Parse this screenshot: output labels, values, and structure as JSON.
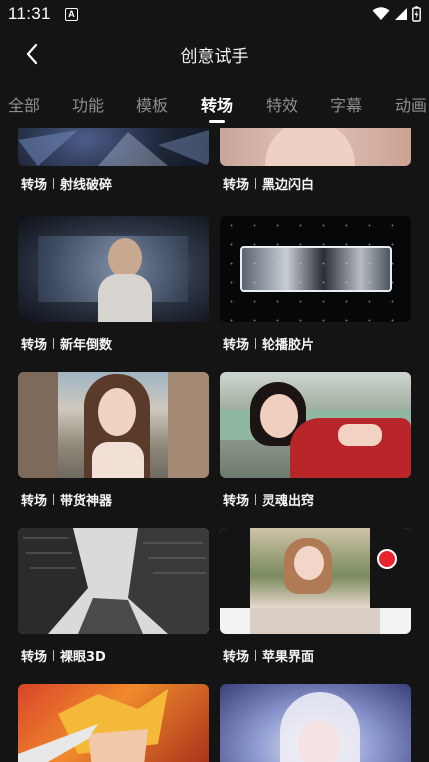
{
  "status": {
    "time": "11:31",
    "a_badge": "A"
  },
  "header": {
    "title": "创意试手"
  },
  "tabs": [
    "全部",
    "功能",
    "模板",
    "转场",
    "特效",
    "字幕",
    "动画"
  ],
  "active_tab": "转场",
  "cards": [
    {
      "category": "转场",
      "name": "射线破碎"
    },
    {
      "category": "转场",
      "name": "黑边闪白"
    },
    {
      "category": "转场",
      "name": "新年倒数"
    },
    {
      "category": "转场",
      "name": "轮播胶片"
    },
    {
      "category": "转场",
      "name": "带货神器"
    },
    {
      "category": "转场",
      "name": "灵魂出窍"
    },
    {
      "category": "转场",
      "name": "裸眼3D"
    },
    {
      "category": "转场",
      "name": "苹果界面"
    }
  ]
}
